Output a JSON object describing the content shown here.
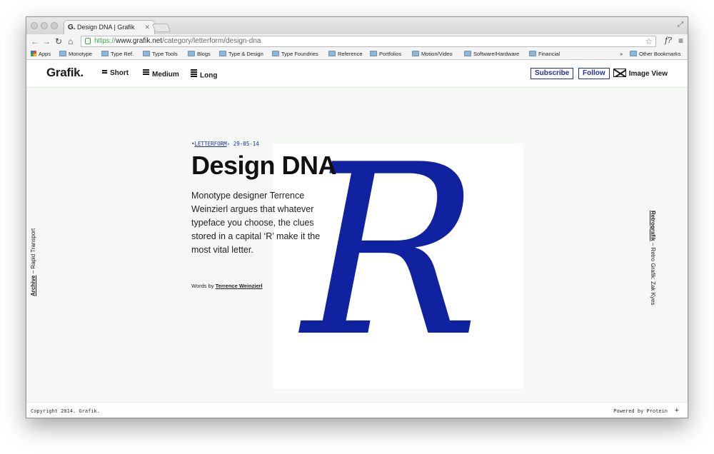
{
  "browser": {
    "tab_title": "Design DNA | Grafik",
    "tab_favicon": "G.",
    "url_scheme": "https://",
    "url_domain": "www.grafik.net",
    "url_path": "/category/letterform/design-dna",
    "bookmarks": [
      "Apps",
      "Monotype",
      "Type Ref.",
      "Type Tools",
      "Blogs",
      "Type & Design",
      "Type Foundries",
      "Reference",
      "Portfolios",
      "Motion/Video",
      "Software/Hardware",
      "Financial"
    ],
    "overflow": "»",
    "other_bookmarks": "Other Bookmarks"
  },
  "header": {
    "logo": "Grafik.",
    "lengths": [
      "Short",
      "Medium",
      "Long"
    ],
    "subscribe": "Subscribe",
    "follow": "Follow",
    "image_view": "Image View"
  },
  "article": {
    "category": "LETTERFORM",
    "date": "29-05-14",
    "title": "Design DNA",
    "description": "Monotype designer Terrence Weinzierl argues that whatever typeface you choose, the clues stored in a capital ‘R’ make it the most vital letter.",
    "words_prefix": "Words by",
    "author": "Terrence Weinzierl",
    "hero_letter": "R"
  },
  "side_nav": {
    "left_label": "Archive",
    "left_title": " – Rapid Transport",
    "right_label": "Retrografik",
    "right_title": " – Retro Grafik: Zak Kyes"
  },
  "footer": {
    "copyright": "Copyright 2014. Grafik.",
    "powered": "Powered by Protein",
    "plus": "+"
  },
  "colors": {
    "accent": "#1f2fa0",
    "hero": "#1022a0"
  },
  "icons": [
    "apps-icon",
    "folder-icon",
    "lock-icon",
    "star-icon",
    "menu-icon",
    "envelope-icon",
    "plus-icon"
  ]
}
